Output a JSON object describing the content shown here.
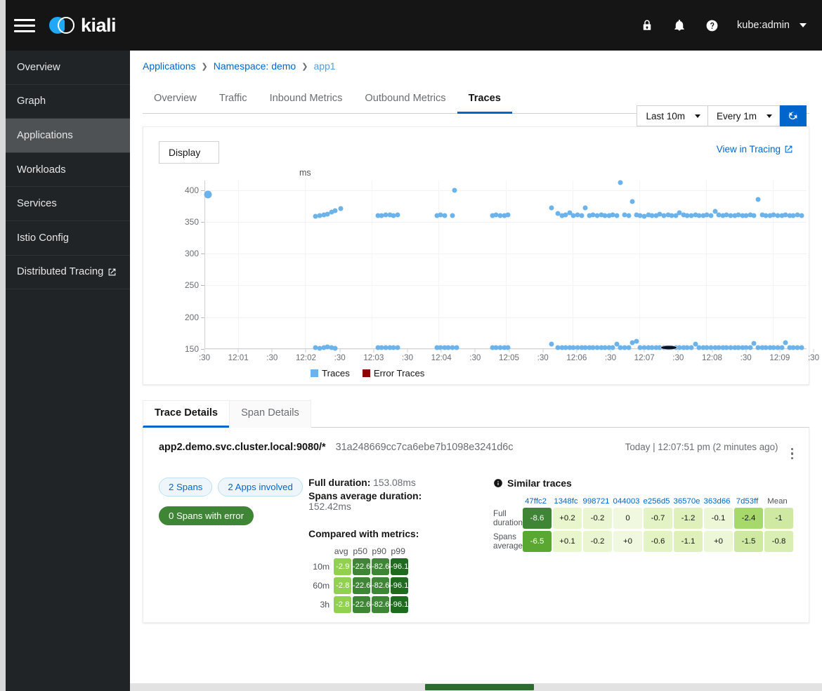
{
  "masthead": {
    "menu_icon": "hamburger-icon",
    "brand": "kiali",
    "icons": [
      "lock-icon",
      "bell-icon",
      "help-icon"
    ],
    "user": "kube:admin"
  },
  "sidebar": {
    "items": [
      {
        "label": "Overview",
        "active": false,
        "external": false
      },
      {
        "label": "Graph",
        "active": false,
        "external": false
      },
      {
        "label": "Applications",
        "active": true,
        "external": false
      },
      {
        "label": "Workloads",
        "active": false,
        "external": false
      },
      {
        "label": "Services",
        "active": false,
        "external": false
      },
      {
        "label": "Istio Config",
        "active": false,
        "external": false
      },
      {
        "label": "Distributed Tracing",
        "active": false,
        "external": true
      }
    ]
  },
  "breadcrumb": {
    "items": [
      "Applications",
      "Namespace: demo",
      "app1"
    ],
    "separator": "›"
  },
  "toolbar": {
    "time_range": "Last 10m",
    "refresh_interval": "Every 1m",
    "refresh_icon": "refresh-icon"
  },
  "tabs": [
    {
      "label": "Overview",
      "active": false
    },
    {
      "label": "Traffic",
      "active": false
    },
    {
      "label": "Inbound Metrics",
      "active": false
    },
    {
      "label": "Outbound Metrics",
      "active": false
    },
    {
      "label": "Traces",
      "active": true
    }
  ],
  "chart_panel": {
    "display_label": "Display",
    "view_in_tracing": "View in Tracing",
    "external_link_icon": "external-link-icon"
  },
  "chart_data": {
    "type": "scatter",
    "title": "",
    "xlabel": "",
    "ylabel": "ms",
    "ylim": [
      150,
      415
    ],
    "yticks": [
      150,
      200,
      250,
      300,
      350,
      400
    ],
    "xticks": [
      ":30",
      "12:01",
      ":30",
      "12:02",
      ":30",
      "12:03",
      ":30",
      "12:04",
      ":30",
      "12:05",
      ":30",
      "12:06",
      ":30",
      "12:07",
      ":30",
      "12:08",
      ":30",
      "12:09",
      ":30"
    ],
    "grid": true,
    "legend_position": "bottom-left",
    "legend": [
      {
        "name": "Traces",
        "color": "#6bb3ea"
      },
      {
        "name": "Error Traces",
        "color": "#8b0000"
      }
    ],
    "series": [
      {
        "name": "Traces",
        "color": "#6bb3ea",
        "points": [
          [
            0.5,
            393
          ],
          [
            17.0,
            359
          ],
          [
            17.6,
            360
          ],
          [
            18.2,
            361
          ],
          [
            18.8,
            362
          ],
          [
            19.4,
            365
          ],
          [
            20.0,
            368
          ],
          [
            20.8,
            371
          ],
          [
            17.0,
            152
          ],
          [
            17.6,
            151
          ],
          [
            18.2,
            152
          ],
          [
            18.8,
            153
          ],
          [
            19.4,
            152
          ],
          [
            20.0,
            151
          ],
          [
            26.5,
            360
          ],
          [
            27.1,
            360
          ],
          [
            27.7,
            361
          ],
          [
            28.3,
            361
          ],
          [
            28.9,
            360
          ],
          [
            29.5,
            361
          ],
          [
            26.5,
            152
          ],
          [
            27.1,
            152
          ],
          [
            27.7,
            152
          ],
          [
            28.3,
            152
          ],
          [
            28.9,
            152
          ],
          [
            29.5,
            152
          ],
          [
            35.5,
            360
          ],
          [
            36.1,
            361
          ],
          [
            36.7,
            360
          ],
          [
            37.9,
            360
          ],
          [
            38.2,
            400
          ],
          [
            35.5,
            152
          ],
          [
            36.1,
            152
          ],
          [
            36.7,
            152
          ],
          [
            37.3,
            152
          ],
          [
            37.9,
            152
          ],
          [
            38.5,
            152
          ],
          [
            44.0,
            360
          ],
          [
            44.6,
            361
          ],
          [
            45.2,
            360
          ],
          [
            45.8,
            360
          ],
          [
            46.4,
            361
          ],
          [
            44.0,
            152
          ],
          [
            44.6,
            152
          ],
          [
            45.2,
            152
          ],
          [
            45.8,
            152
          ],
          [
            46.4,
            152
          ],
          [
            53.0,
            372
          ],
          [
            54.0,
            363
          ],
          [
            54.6,
            360
          ],
          [
            55.2,
            361
          ],
          [
            55.8,
            364
          ],
          [
            56.4,
            360
          ],
          [
            57.0,
            361
          ],
          [
            57.6,
            360
          ],
          [
            58.2,
            372
          ],
          [
            58.8,
            360
          ],
          [
            59.4,
            361
          ],
          [
            60.0,
            360
          ],
          [
            60.6,
            361
          ],
          [
            61.2,
            360
          ],
          [
            61.8,
            360
          ],
          [
            62.4,
            361
          ],
          [
            53.0,
            158
          ],
          [
            54.0,
            152
          ],
          [
            54.6,
            152
          ],
          [
            55.2,
            152
          ],
          [
            55.8,
            152
          ],
          [
            56.4,
            152
          ],
          [
            57.0,
            152
          ],
          [
            57.6,
            152
          ],
          [
            58.2,
            152
          ],
          [
            58.8,
            152
          ],
          [
            59.4,
            152
          ],
          [
            60.0,
            152
          ],
          [
            60.6,
            152
          ],
          [
            61.2,
            152
          ],
          [
            61.8,
            152
          ],
          [
            62.4,
            152
          ],
          [
            63.0,
            360
          ],
          [
            63.6,
            412
          ],
          [
            64.2,
            361
          ],
          [
            64.8,
            360
          ],
          [
            65.4,
            382
          ],
          [
            66.0,
            361
          ],
          [
            66.6,
            360
          ],
          [
            67.2,
            359
          ],
          [
            67.8,
            361
          ],
          [
            68.4,
            360
          ],
          [
            69.0,
            360
          ],
          [
            69.6,
            362
          ],
          [
            70.2,
            360
          ],
          [
            70.8,
            361
          ],
          [
            71.4,
            360
          ],
          [
            72.0,
            360
          ],
          [
            72.6,
            364
          ],
          [
            73.2,
            361
          ],
          [
            73.8,
            360
          ],
          [
            74.4,
            360
          ],
          [
            75.0,
            361
          ],
          [
            75.6,
            360
          ],
          [
            76.2,
            360
          ],
          [
            76.8,
            361
          ],
          [
            77.4,
            360
          ],
          [
            78.0,
            366
          ],
          [
            78.6,
            361
          ],
          [
            79.2,
            360
          ],
          [
            79.8,
            361
          ],
          [
            80.4,
            360
          ],
          [
            81.0,
            360
          ],
          [
            81.6,
            361
          ],
          [
            82.2,
            360
          ],
          [
            82.8,
            360
          ],
          [
            83.4,
            361
          ],
          [
            84.0,
            360
          ],
          [
            84.6,
            385
          ],
          [
            85.2,
            361
          ],
          [
            85.8,
            360
          ],
          [
            86.4,
            360
          ],
          [
            87.0,
            361
          ],
          [
            87.6,
            360
          ],
          [
            88.2,
            360
          ],
          [
            88.8,
            361
          ],
          [
            89.4,
            360
          ],
          [
            90.0,
            360
          ],
          [
            90.6,
            361
          ],
          [
            91.2,
            360
          ],
          [
            63.0,
            158
          ],
          [
            63.6,
            152
          ],
          [
            64.2,
            152
          ],
          [
            64.8,
            152
          ],
          [
            65.4,
            160
          ],
          [
            66.0,
            162
          ],
          [
            66.6,
            152
          ],
          [
            67.2,
            152
          ],
          [
            67.8,
            152
          ],
          [
            68.4,
            152
          ],
          [
            69.0,
            152
          ],
          [
            69.6,
            152
          ],
          [
            70.2,
            152
          ],
          [
            70.8,
            152
          ],
          [
            71.4,
            152
          ],
          [
            72.0,
            152
          ],
          [
            72.6,
            152
          ],
          [
            73.2,
            152
          ],
          [
            73.8,
            152
          ],
          [
            74.4,
            152
          ],
          [
            75.0,
            158
          ],
          [
            75.6,
            152
          ],
          [
            76.2,
            152
          ],
          [
            76.8,
            152
          ],
          [
            77.4,
            152
          ],
          [
            78.0,
            152
          ],
          [
            78.6,
            152
          ],
          [
            79.2,
            152
          ],
          [
            79.8,
            152
          ],
          [
            80.4,
            152
          ],
          [
            81.0,
            152
          ],
          [
            81.6,
            152
          ],
          [
            82.2,
            152
          ],
          [
            82.8,
            152
          ],
          [
            83.4,
            152
          ],
          [
            84.0,
            159
          ],
          [
            84.6,
            152
          ],
          [
            85.2,
            152
          ],
          [
            85.8,
            152
          ],
          [
            86.4,
            152
          ],
          [
            87.0,
            152
          ],
          [
            87.6,
            152
          ],
          [
            88.2,
            152
          ],
          [
            88.8,
            160
          ],
          [
            89.4,
            152
          ],
          [
            90.0,
            152
          ],
          [
            90.6,
            152
          ],
          [
            91.2,
            152
          ]
        ]
      },
      {
        "name": "Error Traces",
        "color": "#8b0000",
        "points": []
      }
    ],
    "selected_point": [
      71.0,
      152
    ]
  },
  "detail": {
    "tabs": [
      {
        "label": "Trace Details",
        "active": true
      },
      {
        "label": "Span Details",
        "active": false
      }
    ],
    "service": "app2.demo.svc.cluster.local:9080/*",
    "trace_id": "31a248669cc7ca6ebe7b1098e3241d6c",
    "timestamp": "Today | 12:07:51 pm (2 minutes ago)",
    "kebab_icon": "kebab-menu-icon",
    "badges": [
      {
        "label": "2 Spans",
        "style": "outline"
      },
      {
        "label": "2 Apps involved",
        "style": "outline"
      },
      {
        "label": "0 Spans with error",
        "style": "green"
      }
    ],
    "full_duration_label": "Full duration:",
    "full_duration_value": "153.08ms",
    "spans_avg_label": "Spans average duration:",
    "spans_avg_value": "152.42ms",
    "compared_title": "Compared with metrics:",
    "metrics_heatmap": {
      "columns": [
        "avg",
        "p50",
        "p90",
        "p99"
      ],
      "rows": [
        {
          "label": "10m",
          "values": [
            "-2.9",
            "-22.6",
            "-82.6",
            "-96.1"
          ]
        },
        {
          "label": "60m",
          "values": [
            "-2.8",
            "-22.6",
            "-82.6",
            "-96.1"
          ]
        },
        {
          "label": "3h",
          "values": [
            "-2.8",
            "-22.6",
            "-82.6",
            "-96.1"
          ]
        }
      ],
      "colors": [
        [
          "#92d050",
          "#3e8635",
          "#3e8635",
          "#1e6b1e"
        ],
        [
          "#92d050",
          "#3e8635",
          "#3e8635",
          "#1e6b1e"
        ],
        [
          "#92d050",
          "#3e8635",
          "#3e8635",
          "#1e6b1e"
        ]
      ]
    },
    "similar": {
      "title": "Similar traces",
      "info_icon": "info-icon",
      "columns": [
        "47ffc2",
        "1348fc",
        "998721",
        "044003",
        "e256d5",
        "36570e",
        "363d66",
        "7d53ff",
        "Mean"
      ],
      "rows": [
        {
          "label": "Full duration",
          "values": [
            "-8.6",
            "+0.2",
            "-0.2",
            "0",
            "-0.7",
            "-1.2",
            "-0.1",
            "-2.4",
            "-1"
          ],
          "colors": [
            "#3e8635",
            "#e8f5cd",
            "#eaf6d2",
            "#f0f9e0",
            "#e4f3c4",
            "#dff0bb",
            "#ecf7d8",
            "#a6d96a",
            "#cfe9a3"
          ],
          "text_colors": [
            "#ffffff",
            "#151515",
            "#151515",
            "#151515",
            "#151515",
            "#151515",
            "#151515",
            "#151515",
            "#151515"
          ]
        },
        {
          "label": "Spans average",
          "values": [
            "-6.5",
            "+0.1",
            "-0.2",
            "+0",
            "-0.6",
            "-1.1",
            "+0",
            "-1.5",
            "-0.8"
          ],
          "colors": [
            "#5aa832",
            "#e8f5cd",
            "#eaf6d2",
            "#f0f9e0",
            "#e4f3c4",
            "#dff0bb",
            "#ecf7d8",
            "#cfe9a3",
            "#d9eeb2"
          ],
          "text_colors": [
            "#ffffff",
            "#151515",
            "#151515",
            "#151515",
            "#151515",
            "#151515",
            "#151515",
            "#151515",
            "#151515"
          ]
        }
      ]
    }
  }
}
